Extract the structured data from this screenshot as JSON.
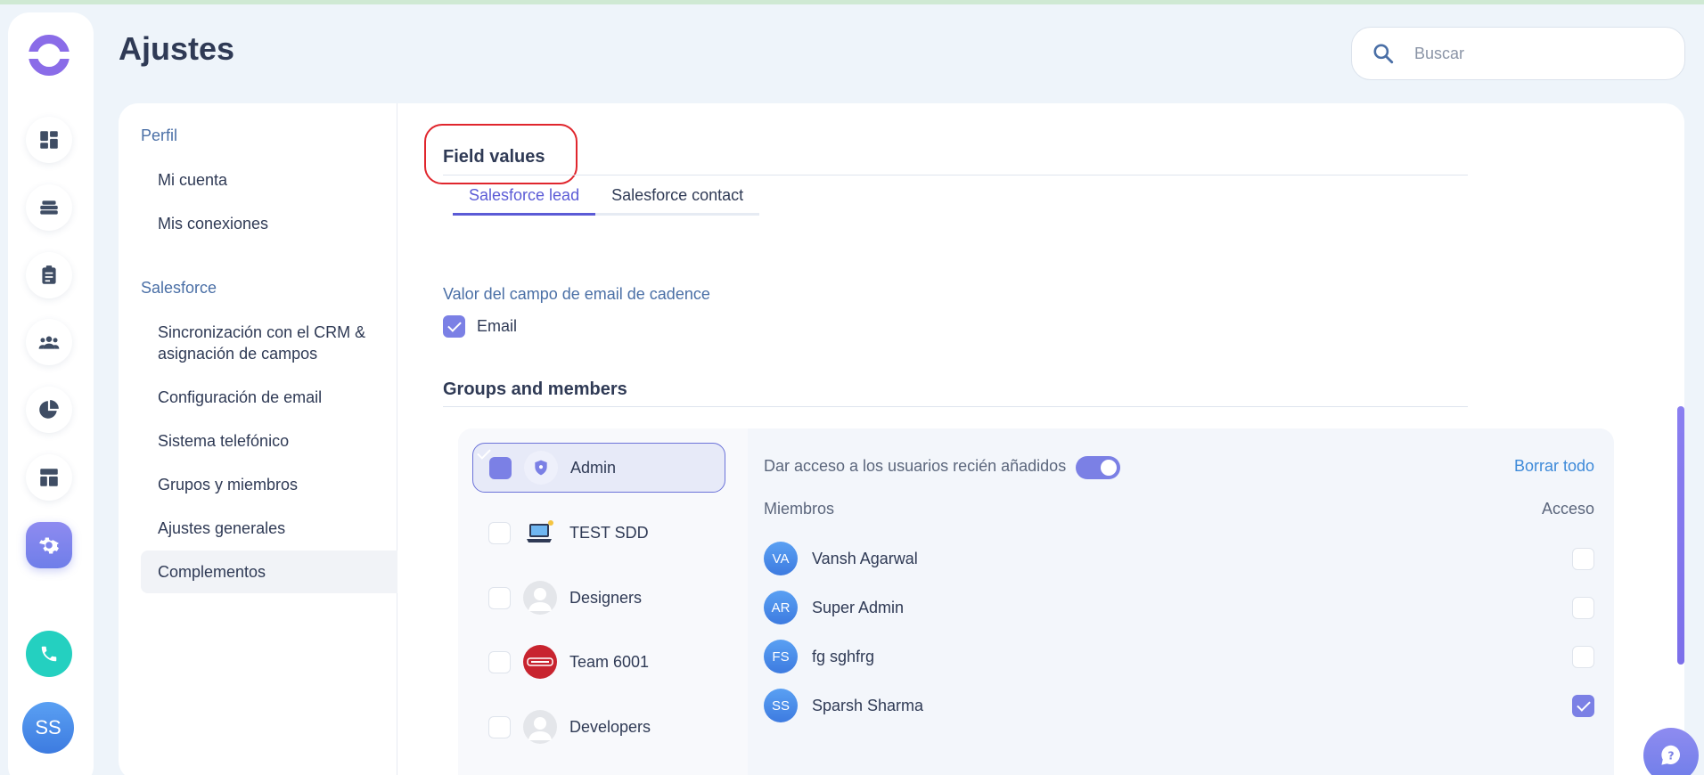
{
  "page": {
    "title": "Ajustes"
  },
  "search": {
    "placeholder": "Buscar"
  },
  "rail": {
    "items": [
      "dashboard-icon",
      "inbox-icon",
      "tasks-icon",
      "contacts-icon",
      "analytics-icon",
      "templates-icon",
      "settings-icon"
    ],
    "avatar_initials": "SS"
  },
  "nav": {
    "section_profile": "Perfil",
    "mi_cuenta": "Mi cuenta",
    "mis_conexiones": "Mis conexiones",
    "section_salesforce": "Salesforce",
    "sync_line1": "Sincronización con el CRM &",
    "sync_line2": "asignación de campos",
    "email_config": "Configuración de email",
    "phone_system": "Sistema telefónico",
    "groups": "Grupos y miembros",
    "general": "Ajustes generales",
    "addons": "Complementos"
  },
  "field_values": {
    "title": "Field values",
    "tabs": [
      "Salesforce lead",
      "Salesforce contact"
    ],
    "email_field_label": "Valor del campo de email de cadence",
    "email_option": "Email"
  },
  "groups_section": {
    "title": "Groups and members",
    "groups": [
      {
        "name": "Admin",
        "checked": true
      },
      {
        "name": "TEST SDD",
        "checked": false
      },
      {
        "name": "Designers",
        "checked": false
      },
      {
        "name": "Team 6001",
        "checked": false
      },
      {
        "name": "Developers",
        "checked": false
      }
    ],
    "access_new_users": "Dar acceso a los usuarios recién añadidos",
    "clear_all": "Borrar todo",
    "members_header": "Miembros",
    "access_header": "Acceso",
    "members": [
      {
        "initials": "VA",
        "name": "Vansh Agarwal",
        "access": false
      },
      {
        "initials": "AR",
        "name": "Super Admin",
        "access": false
      },
      {
        "initials": "FS",
        "name": "fg sghfrg",
        "access": false
      },
      {
        "initials": "SS",
        "name": "Sparsh Sharma",
        "access": true
      }
    ]
  },
  "colors": {
    "accent": "#7b80e5",
    "link": "#3e8ad9",
    "highlight": "#e0262d",
    "teal": "#24d0c0"
  }
}
